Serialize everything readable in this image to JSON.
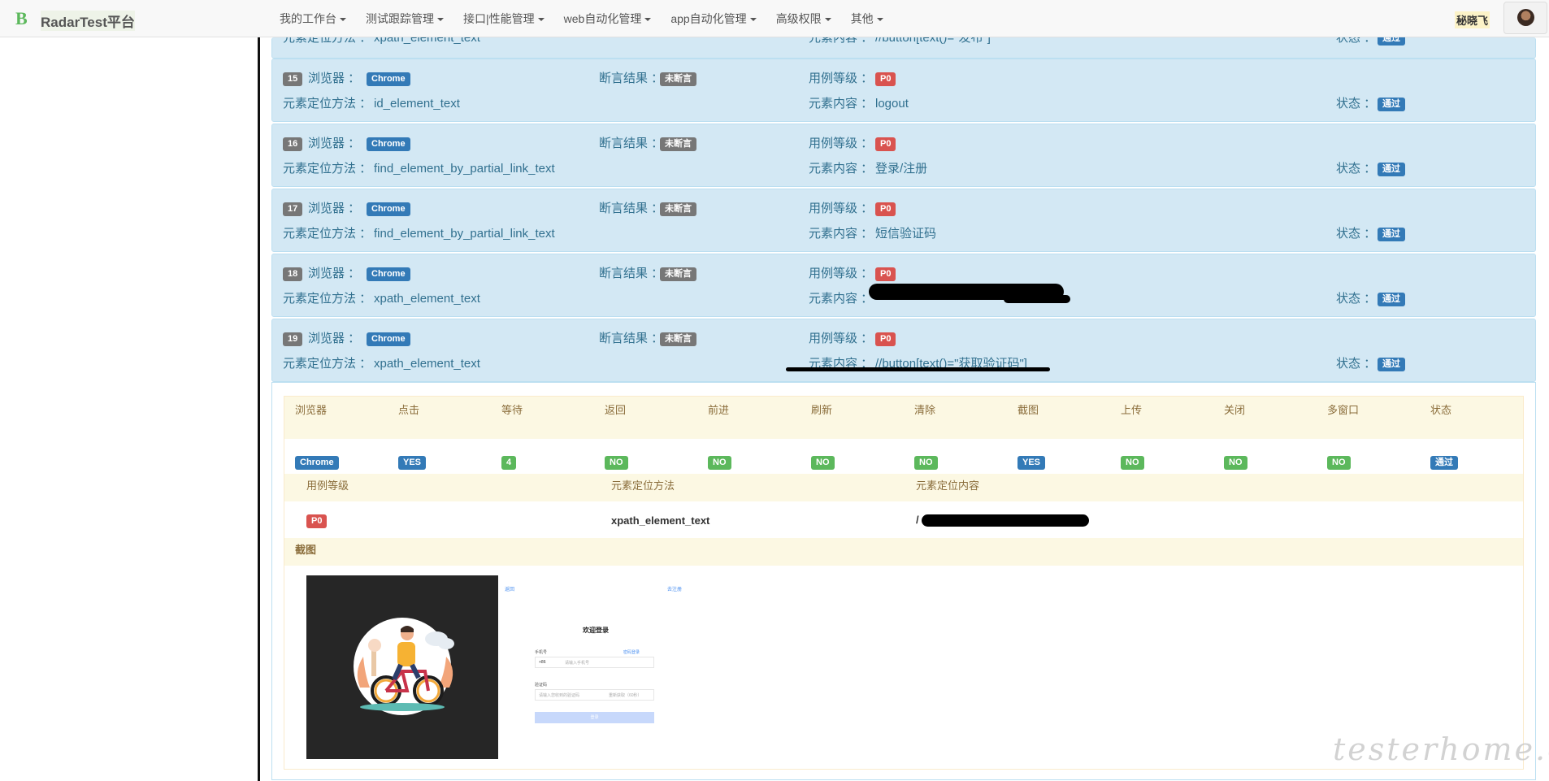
{
  "navbar": {
    "logo": "B",
    "brand": "RadarTest平台",
    "menu": [
      {
        "label": "我的工作台"
      },
      {
        "label": "测试跟踪管理"
      },
      {
        "label": "接口|性能管理"
      },
      {
        "label": "web自动化管理"
      },
      {
        "label": "app自动化管理"
      },
      {
        "label": "高级权限"
      },
      {
        "label": "其他"
      }
    ],
    "user": "秘晓飞"
  },
  "labels": {
    "browser": "浏览器 ：",
    "assert": "断言结果 ：",
    "level": "用例等级 ：",
    "locate": "元素定位方法 ：",
    "content": "元素内容 ：",
    "status": "状态 ："
  },
  "top_partial": {
    "method": "xpath_element_text",
    "content": "//button[text()=\"发布\"]",
    "status": "通过"
  },
  "steps": [
    {
      "num": "15",
      "browser": "Chrome",
      "assert": "未断言",
      "level": "P0",
      "method": "id_element_text",
      "content": "logout",
      "status": "通过"
    },
    {
      "num": "16",
      "browser": "Chrome",
      "assert": "未断言",
      "level": "P0",
      "method": "find_element_by_partial_link_text",
      "content": "登录/注册",
      "status": "通过"
    },
    {
      "num": "17",
      "browser": "Chrome",
      "assert": "未断言",
      "level": "P0",
      "method": "find_element_by_partial_link_text",
      "content": "短信验证码",
      "status": "通过"
    },
    {
      "num": "18",
      "browser": "Chrome",
      "assert": "未断言",
      "level": "P0",
      "method": "xpath_element_text",
      "content": "",
      "status": "通过"
    },
    {
      "num": "19",
      "browser": "Chrome",
      "assert": "未断言",
      "level": "P0",
      "method": "xpath_element_text",
      "content": "//button[text()=\"获取验证码\"]",
      "status": "通过"
    }
  ],
  "detail": {
    "columns": [
      "浏览器",
      "点击",
      "等待",
      "返回",
      "前进",
      "刷新",
      "清除",
      "截图",
      "上传",
      "关闭",
      "多窗口",
      "状态"
    ],
    "values": [
      "Chrome",
      "YES",
      "4",
      "NO",
      "NO",
      "NO",
      "NO",
      "YES",
      "NO",
      "NO",
      "NO",
      "通过"
    ],
    "value_colors": [
      "blue",
      "blue",
      "green",
      "green",
      "green",
      "green",
      "green",
      "blue",
      "green",
      "green",
      "green",
      "blue"
    ],
    "sub_columns": [
      "用例等级",
      "元素定位方法",
      "元素定位内容"
    ],
    "sub_values": {
      "level": "P0",
      "method": "xpath_element_text",
      "content": "/"
    },
    "screenshot_label": "截图",
    "screenshot": {
      "back": "返回",
      "next": "去注册",
      "title": "欢迎登录",
      "phone_label": "手机号",
      "pwd_login": "密码登录",
      "country_code": "+86",
      "phone_placeholder": "请输入手机号",
      "code_label": "验证码",
      "code_placeholder": "请输入您收到的验证码",
      "get_code": "重新获取（60秒）",
      "login_button": "登录"
    }
  },
  "watermark": "testerhome.com",
  "colors": {
    "info_bg": "#d3e8f4",
    "info_text": "#31708f",
    "warning_bg": "#fcf8e3",
    "warning_text": "#8a6d3b",
    "primary": "#337ab7",
    "success": "#5cb85c",
    "danger": "#d9534f",
    "default": "#777777"
  }
}
